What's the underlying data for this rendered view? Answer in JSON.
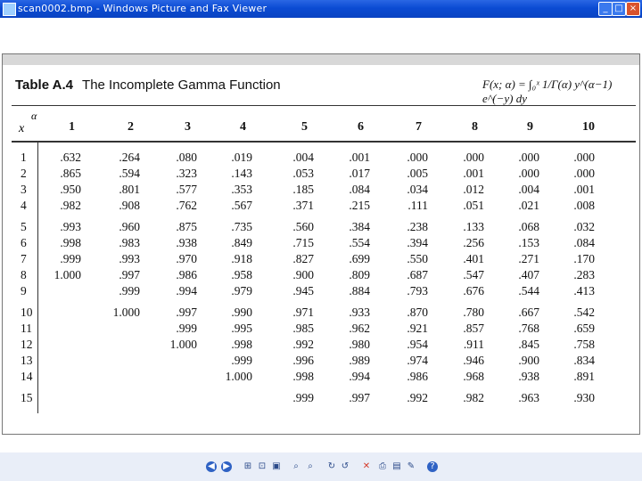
{
  "window": {
    "title": "scan0002.bmp - Windows Picture and Fax Viewer",
    "controls": [
      "_",
      "□",
      "×"
    ]
  },
  "table": {
    "title_label": "Table A.4",
    "title_text": "The Incomplete Gamma Function",
    "formula": "F(x; α) = ∫₀ˣ 1/Γ(α) y^(α−1) e^(−y) dy",
    "corner_x": "x",
    "corner_alpha": "α",
    "alpha_headers": [
      "1",
      "2",
      "3",
      "4",
      "5",
      "6",
      "7",
      "8",
      "9",
      "10"
    ],
    "x_values": [
      "1",
      "2",
      "3",
      "4",
      "5",
      "6",
      "7",
      "8",
      "9",
      "10",
      "11",
      "12",
      "13",
      "14",
      "15"
    ],
    "columns": [
      [
        ".632",
        ".865",
        ".950",
        ".982",
        ".993",
        ".998",
        ".999",
        "1.000",
        "",
        "",
        "",
        "",
        "",
        "",
        ""
      ],
      [
        ".264",
        ".594",
        ".801",
        ".908",
        ".960",
        ".983",
        ".993",
        ".997",
        ".999",
        "1.000",
        "",
        "",
        "",
        "",
        ""
      ],
      [
        ".080",
        ".323",
        ".577",
        ".762",
        ".875",
        ".938",
        ".970",
        ".986",
        ".994",
        ".997",
        ".999",
        "1.000",
        "",
        "",
        ""
      ],
      [
        ".019",
        ".143",
        ".353",
        ".567",
        ".735",
        ".849",
        ".918",
        ".958",
        ".979",
        ".990",
        ".995",
        ".998",
        ".999",
        "1.000",
        ""
      ],
      [
        ".004",
        ".053",
        ".185",
        ".371",
        ".560",
        ".715",
        ".827",
        ".900",
        ".945",
        ".971",
        ".985",
        ".992",
        ".996",
        ".998",
        ".999"
      ],
      [
        ".001",
        ".017",
        ".084",
        ".215",
        ".384",
        ".554",
        ".699",
        ".809",
        ".884",
        ".933",
        ".962",
        ".980",
        ".989",
        ".994",
        ".997"
      ],
      [
        ".000",
        ".005",
        ".034",
        ".111",
        ".238",
        ".394",
        ".550",
        ".687",
        ".793",
        ".870",
        ".921",
        ".954",
        ".974",
        ".986",
        ".992"
      ],
      [
        ".000",
        ".001",
        ".012",
        ".051",
        ".133",
        ".256",
        ".401",
        ".547",
        ".676",
        ".780",
        ".857",
        ".911",
        ".946",
        ".968",
        ".982"
      ],
      [
        ".000",
        ".000",
        ".004",
        ".021",
        ".068",
        ".153",
        ".271",
        ".407",
        ".544",
        ".667",
        ".768",
        ".845",
        ".900",
        ".938",
        ".963"
      ],
      [
        ".000",
        ".000",
        ".001",
        ".008",
        ".032",
        ".084",
        ".170",
        ".283",
        ".413",
        ".542",
        ".659",
        ".758",
        ".834",
        ".891",
        ".930"
      ]
    ]
  },
  "toolbar": {
    "icons": [
      "previous-image-icon",
      "next-image-icon",
      "best-fit-icon",
      "actual-size-icon",
      "slideshow-icon",
      "zoom-in-icon",
      "zoom-out-icon",
      "rotate-clockwise-icon",
      "rotate-counterclockwise-icon",
      "delete-icon",
      "print-icon",
      "save-icon",
      "edit-icon",
      "help-icon"
    ]
  }
}
